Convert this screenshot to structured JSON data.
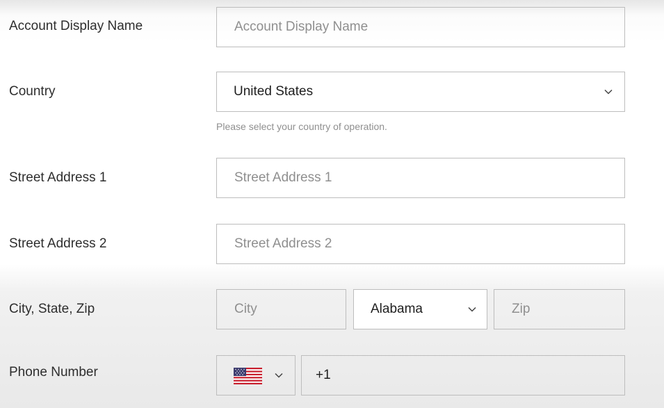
{
  "form": {
    "account_display_name": {
      "label": "Account Display Name",
      "placeholder": "Account Display Name",
      "value": ""
    },
    "country": {
      "label": "Country",
      "selected": "United States",
      "helper": "Please select your country of operation."
    },
    "street_address_1": {
      "label": "Street Address 1",
      "placeholder": "Street Address 1",
      "value": ""
    },
    "street_address_2": {
      "label": "Street Address 2",
      "placeholder": "Street Address 2",
      "value": ""
    },
    "city_state_zip": {
      "label": "City, State, Zip",
      "city_placeholder": "City",
      "state_selected": "Alabama",
      "zip_placeholder": "Zip"
    },
    "phone": {
      "label": "Phone Number",
      "country_flag": "us-flag-icon",
      "value": "+1"
    }
  },
  "colors": {
    "border": "#bdbdbd",
    "placeholder": "#8f8f8f",
    "text": "#1f1f1f",
    "label": "#2e2e2e"
  }
}
